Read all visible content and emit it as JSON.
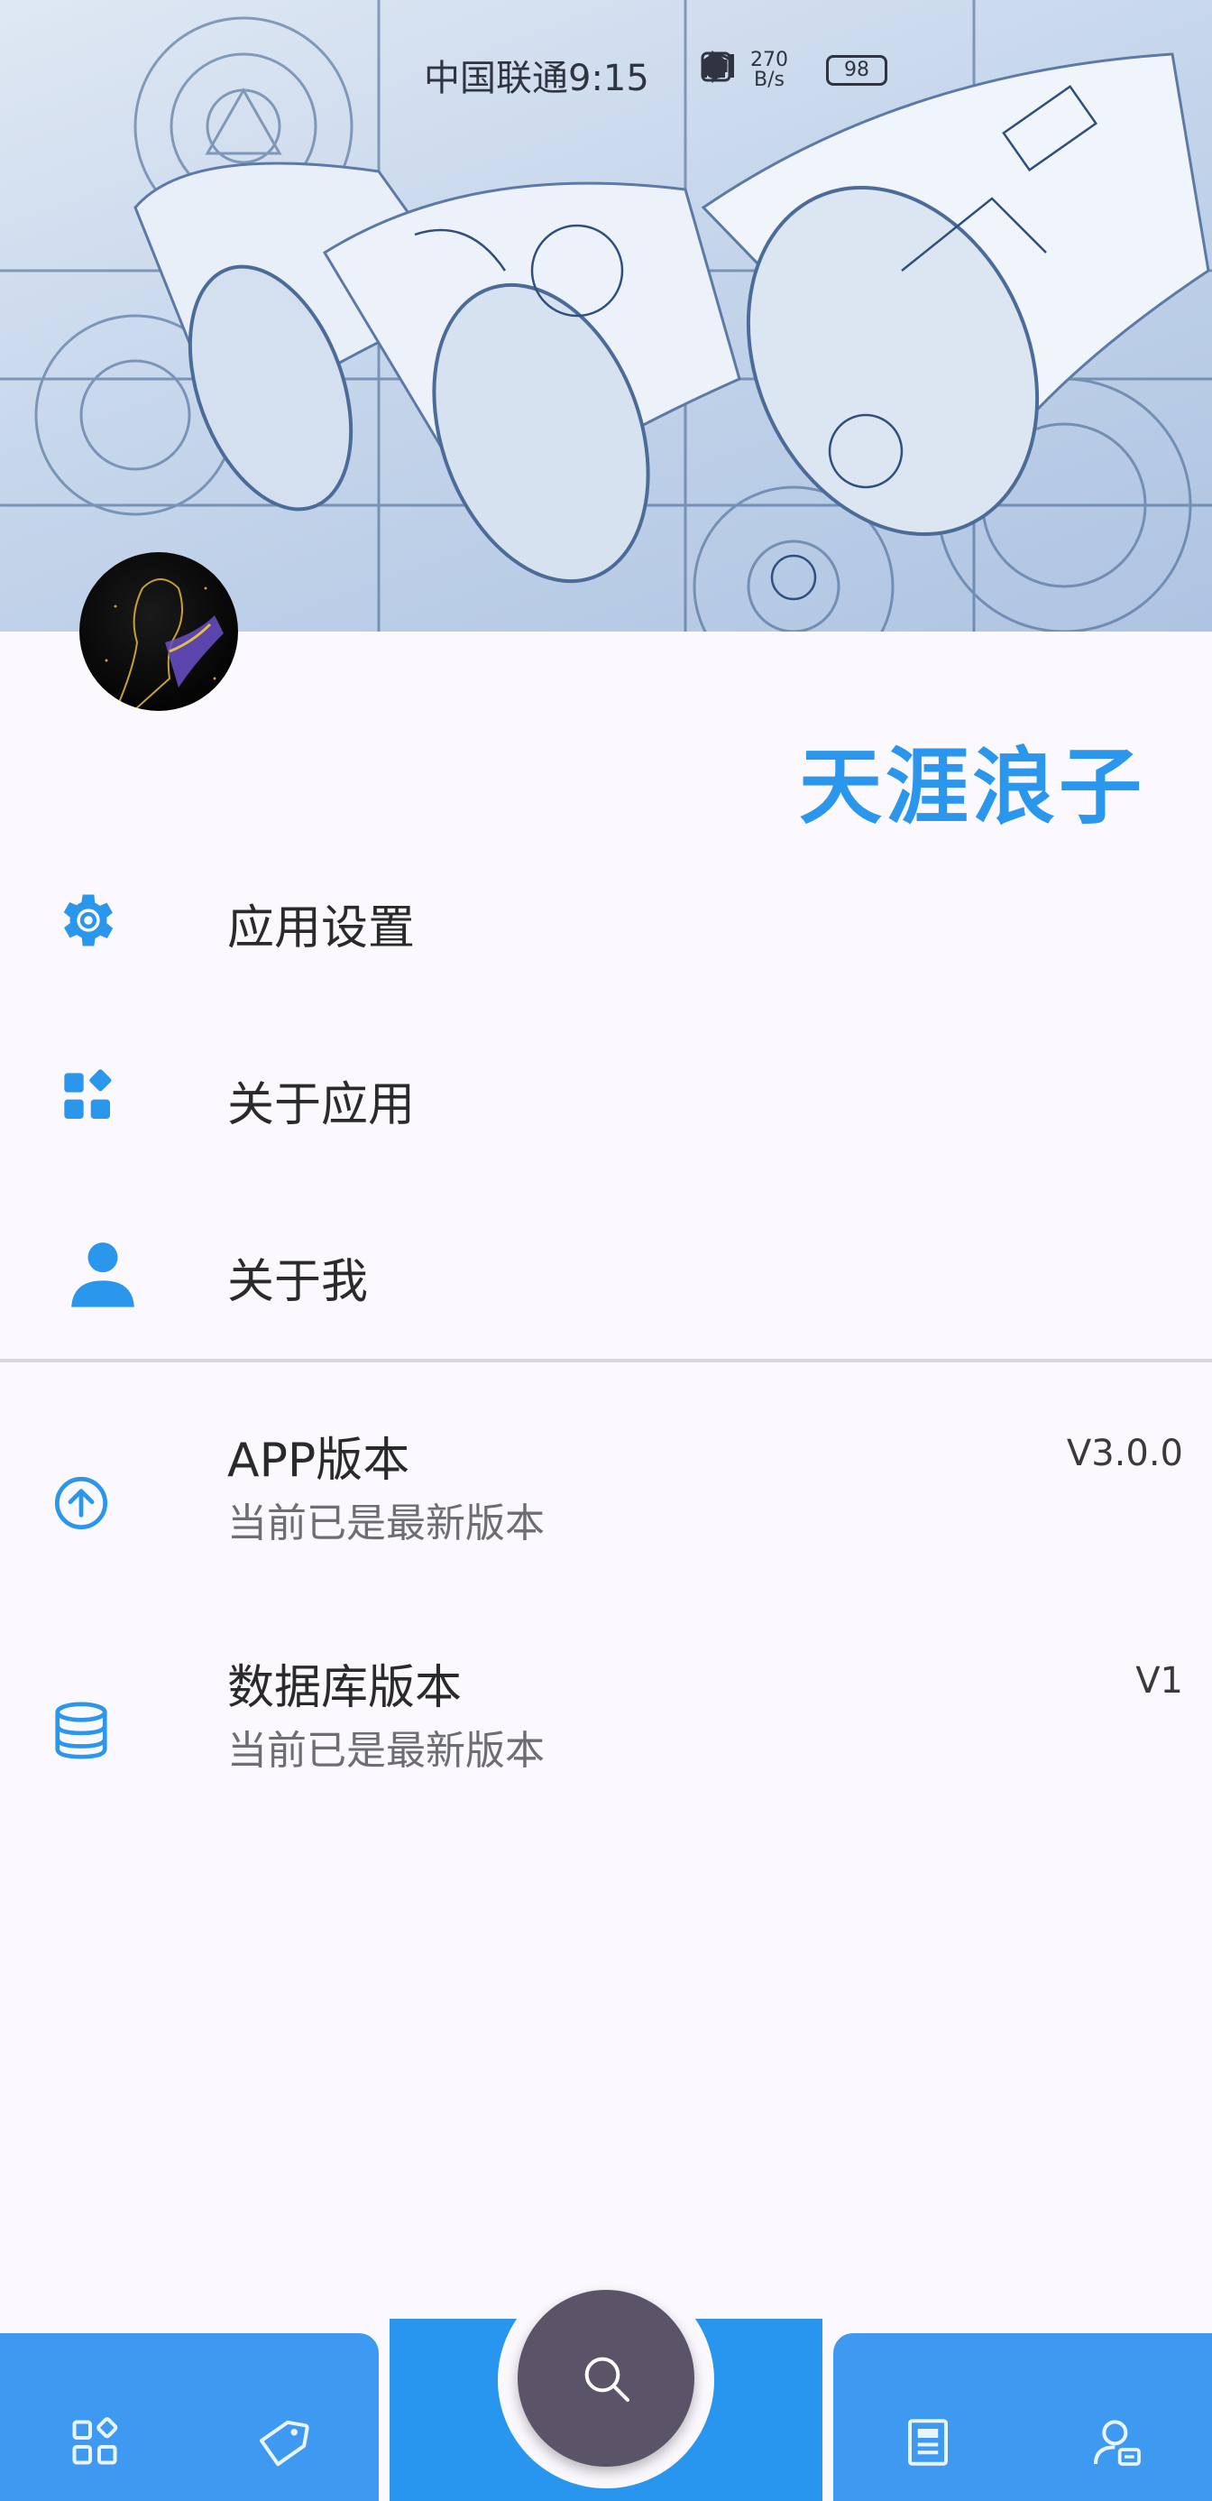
{
  "status_bar": {
    "carrier": "中国联通",
    "time": "9:15",
    "speed_value": "270",
    "speed_unit": "B/s",
    "battery": "98"
  },
  "profile": {
    "username": "天涯浪子"
  },
  "menu": [
    {
      "label": "应用设置",
      "icon": "gear-icon"
    },
    {
      "label": "关于应用",
      "icon": "apps-icon"
    },
    {
      "label": "关于我",
      "icon": "person-icon"
    }
  ],
  "versions": [
    {
      "title": "APP版本",
      "subtitle": "当前已是最新版本",
      "value": "V3.0.0",
      "icon": "arrow-up-circle-icon"
    },
    {
      "title": "数据库版本",
      "subtitle": "当前已是最新版本",
      "value": "V1",
      "icon": "database-icon"
    }
  ],
  "bottom_nav": {
    "items": [
      "grid-icon",
      "tag-icon",
      "search-icon",
      "document-icon",
      "user-card-icon"
    ]
  },
  "colors": {
    "accent": "#2a96ec",
    "nav_bar": "#3d9af0",
    "fab": "#5b5468",
    "background": "#fbf9fd"
  }
}
